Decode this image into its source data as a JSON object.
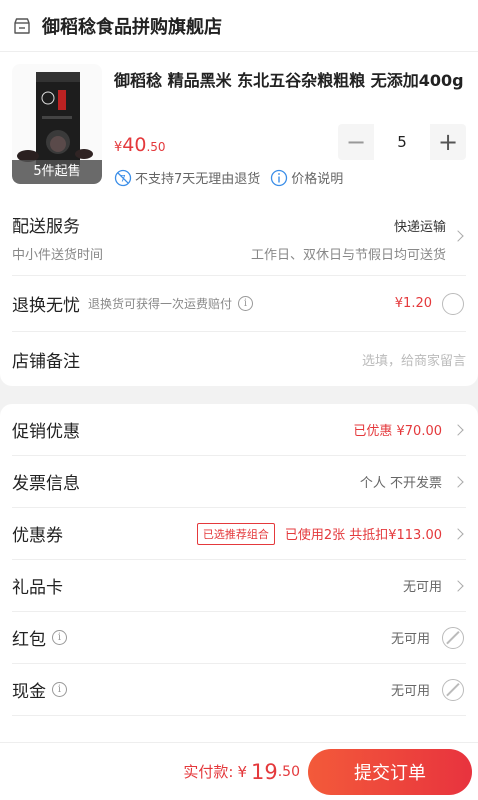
{
  "shop": {
    "name": "御稻稔食品拼购旗舰店"
  },
  "product": {
    "title": "御稻稔 精品黑米 东北五谷杂粮粗粮 无添加400g",
    "price_currency": "¥",
    "price_int": "40",
    "price_dec": ".50",
    "min_sale": "5件起售",
    "quantity": "5",
    "minus": "−",
    "plus": "+",
    "tag_no_return": "不支持7天无理由退货",
    "tag_price_desc": "价格说明"
  },
  "delivery": {
    "label": "配送服务",
    "sub": "中小件送货时间",
    "method": "快递运输",
    "time": "工作日、双休日与节假日均可送货"
  },
  "refund": {
    "label": "退换无忧",
    "desc": "退换货可获得一次运费赔付",
    "price": "¥1.20"
  },
  "remark": {
    "label": "店铺备注",
    "placeholder": "选填，给商家留言"
  },
  "promo": {
    "label": "促销优惠",
    "value": "已优惠 ¥70.00"
  },
  "invoice": {
    "label": "发票信息",
    "value": "个人 不开发票"
  },
  "coupon": {
    "label": "优惠券",
    "badge": "已选推荐组合",
    "value": "已使用2张 共抵扣¥113.00"
  },
  "giftcard": {
    "label": "礼品卡",
    "value": "无可用"
  },
  "redpacket": {
    "label": "红包",
    "value": "无可用"
  },
  "cash": {
    "label": "现金",
    "value": "无可用"
  },
  "footer": {
    "total_label": "实付款:",
    "total_currency": "¥",
    "total_int": "19",
    "total_dec": ".50",
    "submit": "提交订单"
  },
  "colors": {
    "accent": "#e4393c",
    "button": "#ef3f3b"
  }
}
